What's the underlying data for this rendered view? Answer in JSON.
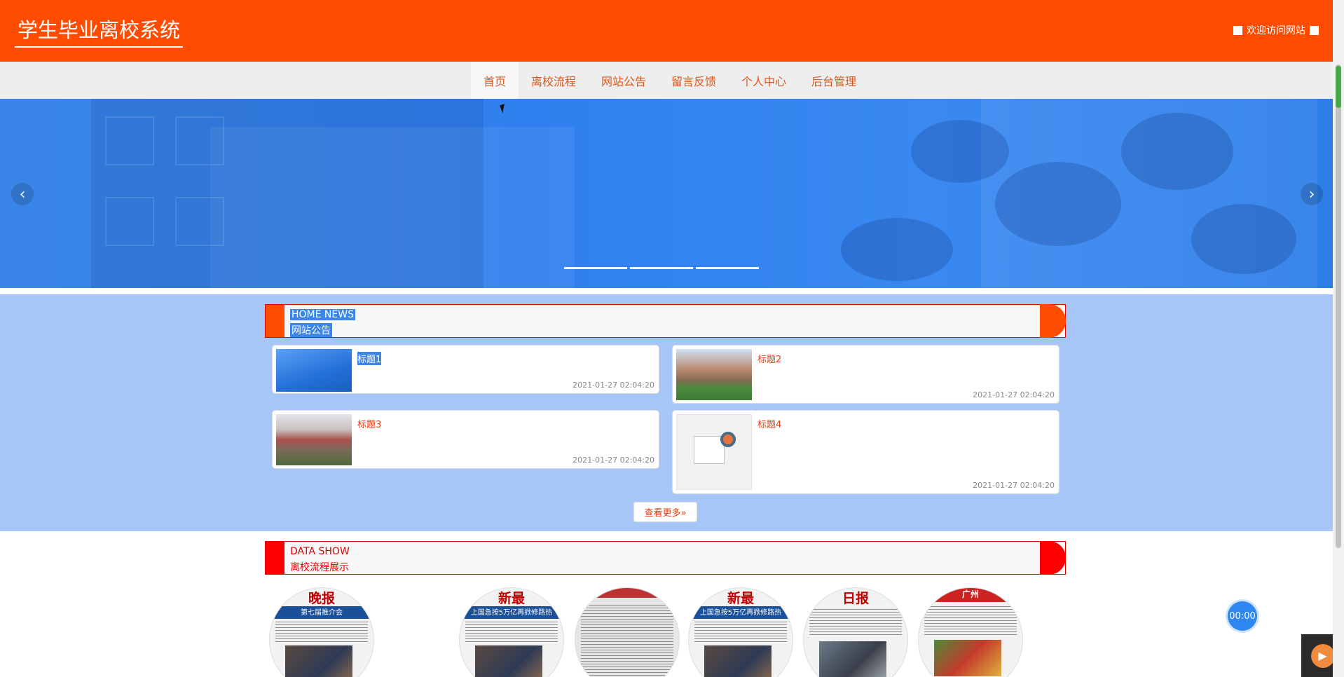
{
  "header": {
    "site_title": "学生毕业离校系统",
    "welcome_text": "欢迎访问网站"
  },
  "nav": {
    "items": [
      {
        "label": "首页",
        "active": true
      },
      {
        "label": "离校流程"
      },
      {
        "label": "网站公告"
      },
      {
        "label": "留言反馈"
      },
      {
        "label": "个人中心"
      },
      {
        "label": "后台管理"
      }
    ]
  },
  "banner": {
    "prev_icon": "chevron-left-icon",
    "next_icon": "chevron-right-icon",
    "prev_glyph": "‹",
    "next_glyph": "›",
    "slides": 3
  },
  "news": {
    "title_en": "HOME NEWS",
    "title_cn": "网站公告",
    "items": [
      {
        "title": "标题1",
        "date": "2021-01-27 02:04:20"
      },
      {
        "title": "标题2",
        "date": "2021-01-27 02:04:20"
      },
      {
        "title": "标题3",
        "date": "2021-01-27 02:04:20"
      },
      {
        "title": "标题4",
        "date": "2021-01-27 02:04:20"
      }
    ],
    "more_label": "查看更多»"
  },
  "data_show": {
    "title_en": "DATA SHOW",
    "title_cn": "离校流程展示",
    "items": [
      {
        "masthead": "晚报",
        "headline": "第七届推介会"
      },
      {
        "masthead": "新最",
        "headline": "上国急按5万亿再掀修路热"
      },
      {
        "masthead": "",
        "headline": ""
      },
      {
        "masthead": "新最",
        "headline": "上国急按5万亿再掀修路热"
      },
      {
        "masthead": "日报",
        "headline": ""
      },
      {
        "masthead": "",
        "headline": "广州"
      }
    ]
  },
  "widgets": {
    "timer": "00:00",
    "play_glyph": "▶"
  },
  "colors": {
    "header_bg": "#ff4c00",
    "nav_text": "#e0561a",
    "news_bg": "#a6c6f8",
    "accent_red": "#ff0000"
  }
}
